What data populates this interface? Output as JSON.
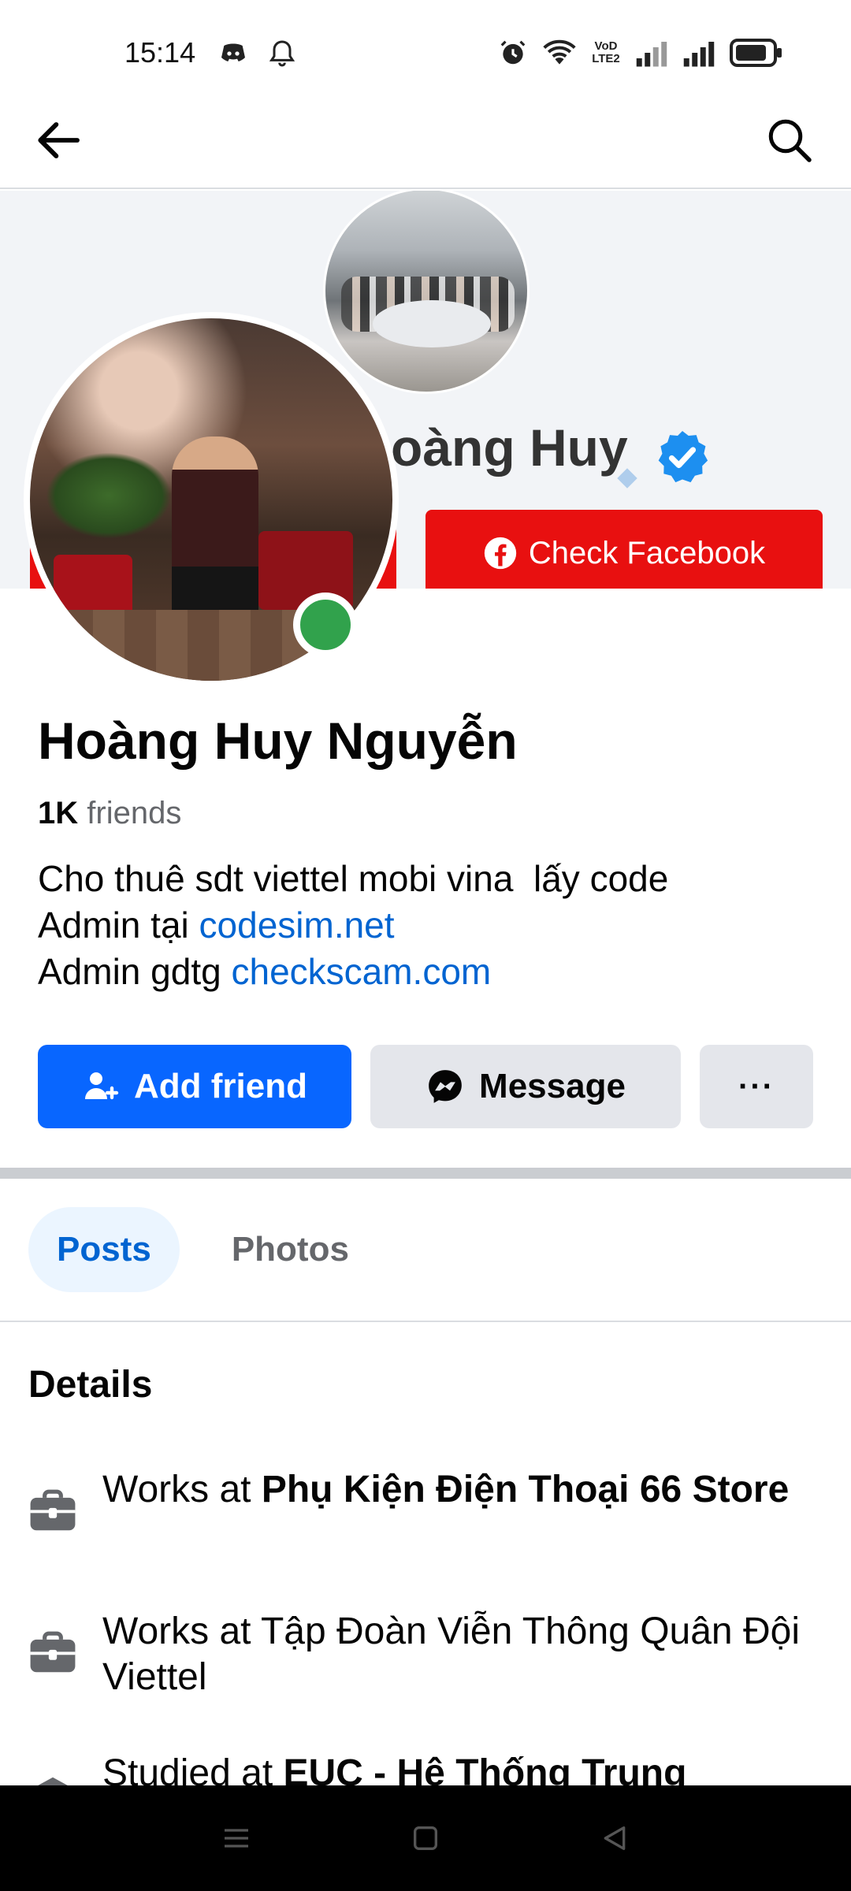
{
  "status_bar": {
    "time": "15:14",
    "left_icons": [
      "discord-icon",
      "bell-icon"
    ],
    "right_icons": [
      "alarm-icon",
      "wifi-icon",
      "volte-icon",
      "signal-icon",
      "signal-icon",
      "battery-icon"
    ],
    "volte_text": "VoD LTE2"
  },
  "app_bar": {
    "back_icon": "arrow-left-icon",
    "search_icon": "search-icon"
  },
  "cover": {
    "title_partial": "oàng Huy",
    "button_label": "Check Facebook",
    "button_icon": "facebook-icon",
    "accent_color": "#e81010"
  },
  "profile": {
    "name": "Hoàng Huy Nguyễn",
    "friends_count": "1K",
    "friends_label": "friends",
    "online": true,
    "bio": {
      "line1": "Cho thuê sdt viettel mobi vina  lấy code",
      "line2_prefix": "Admin tại ",
      "line2_link": "codesim.net",
      "line3_prefix": "Admin gdtg ",
      "line3_link": "checkscam.com"
    }
  },
  "actions": {
    "add_friend": "Add friend",
    "message": "Message",
    "more": "···"
  },
  "tabs": [
    {
      "label": "Posts",
      "active": true
    },
    {
      "label": "Photos",
      "active": false
    }
  ],
  "details": {
    "title": "Details",
    "items": [
      {
        "prefix": "Works at ",
        "bold": "Phụ Kiện Điện Thoại 66 Store",
        "icon": "briefcase-icon"
      },
      {
        "prefix": "Works at Tập Đoàn Viễn Thông Quân Đội Viettel",
        "bold": "",
        "icon": "briefcase-icon"
      },
      {
        "prefix": "Studied at ",
        "bold": "EUC - Hệ Thống Trung",
        "icon": "graduation-cap-icon"
      }
    ]
  },
  "colors": {
    "primary": "#0866ff",
    "link": "#0064d1",
    "online": "#31a24c"
  }
}
